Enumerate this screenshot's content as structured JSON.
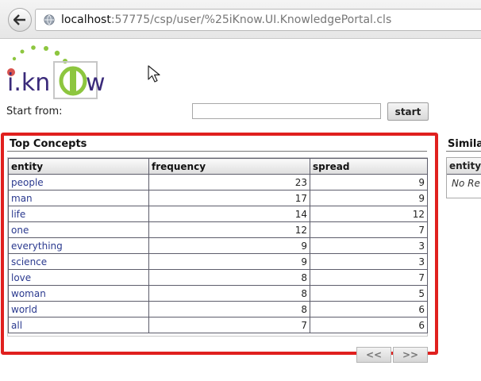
{
  "browser": {
    "url_host": "localhost",
    "url_rest": ":57775/csp/user/%25iKnow.UI.KnowledgePortal.cls"
  },
  "logo": {
    "text": "i.kn",
    "text_end": "w"
  },
  "search": {
    "label": "Start from:",
    "value": "",
    "button_label": "start"
  },
  "top_concepts": {
    "title": "Top Concepts",
    "columns": [
      "entity",
      "frequency",
      "spread"
    ],
    "rows": [
      {
        "entity": "people",
        "frequency": "23",
        "spread": "9"
      },
      {
        "entity": "man",
        "frequency": "17",
        "spread": "9"
      },
      {
        "entity": "life",
        "frequency": "14",
        "spread": "12"
      },
      {
        "entity": "one",
        "frequency": "12",
        "spread": "7"
      },
      {
        "entity": "everything",
        "frequency": "9",
        "spread": "3"
      },
      {
        "entity": "science",
        "frequency": "9",
        "spread": "3"
      },
      {
        "entity": "love",
        "frequency": "8",
        "spread": "7"
      },
      {
        "entity": "woman",
        "frequency": "8",
        "spread": "5"
      },
      {
        "entity": "world",
        "frequency": "8",
        "spread": "6"
      },
      {
        "entity": "all",
        "frequency": "7",
        "spread": "6"
      }
    ],
    "pager": {
      "prev": "<<",
      "next": ">>"
    }
  },
  "similar": {
    "title": "Simila",
    "column": "entity",
    "empty_text": "No Re"
  },
  "colors": {
    "highlight": "#e0201e",
    "entity_link": "#2b3a8f",
    "logo_green": "#8dc63f",
    "logo_red": "#d9534f",
    "logo_purple": "#3a2a7a"
  },
  "icons": {
    "back": "back-arrow-icon",
    "globe": "globe-icon",
    "cursor": "mouse-pointer-icon"
  }
}
